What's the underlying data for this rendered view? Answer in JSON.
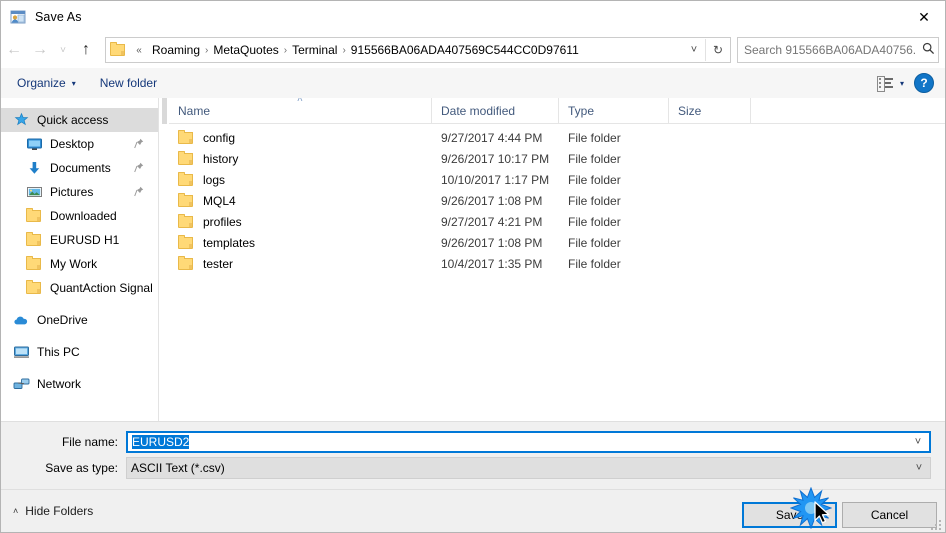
{
  "window": {
    "title": "Save As",
    "app_icon": "save-as-icon",
    "close_label": "✕"
  },
  "nav": {
    "back": "←",
    "forward": "→",
    "recent": "˅",
    "up": "↑",
    "refresh": "↻",
    "crumb_chevron": "«",
    "separator": "›",
    "breadcrumbs": [
      "Roaming",
      "MetaQuotes",
      "Terminal",
      "915566BA06ADA407569C544CC0D97611"
    ],
    "address_dropdown": "˅"
  },
  "search": {
    "placeholder": "Search 915566BA06ADA40756...",
    "value": "",
    "icon": "search-icon"
  },
  "toolbar": {
    "organize_label": "Organize",
    "organize_caret": "▾",
    "new_folder_label": "New folder",
    "view_caret": "▾",
    "help_label": "?"
  },
  "sidebar": {
    "items": [
      {
        "label": "Quick access",
        "icon": "star-icon",
        "selected": true,
        "indent": false,
        "pinned": false
      },
      {
        "label": "Desktop",
        "icon": "monitor-icon",
        "selected": false,
        "indent": true,
        "pinned": true
      },
      {
        "label": "Documents",
        "icon": "download-arrow-icon",
        "selected": false,
        "indent": true,
        "pinned": true
      },
      {
        "label": "Pictures",
        "icon": "picture-icon",
        "selected": false,
        "indent": true,
        "pinned": true
      },
      {
        "label": "Downloaded",
        "icon": "folder-icon",
        "selected": false,
        "indent": true,
        "pinned": false
      },
      {
        "label": "EURUSD H1",
        "icon": "folder-icon",
        "selected": false,
        "indent": true,
        "pinned": false
      },
      {
        "label": "My Work",
        "icon": "folder-icon",
        "selected": false,
        "indent": true,
        "pinned": false
      },
      {
        "label": "QuantAction Signal",
        "icon": "folder-icon",
        "selected": false,
        "indent": true,
        "pinned": false
      },
      {
        "label": "OneDrive",
        "icon": "cloud-icon",
        "selected": false,
        "indent": false,
        "pinned": false
      },
      {
        "label": "This PC",
        "icon": "computer-icon",
        "selected": false,
        "indent": false,
        "pinned": false
      },
      {
        "label": "Network",
        "icon": "network-icon",
        "selected": false,
        "indent": false,
        "pinned": false
      }
    ],
    "pin_glyph": "📌"
  },
  "filelist": {
    "columns": [
      "Name",
      "Date modified",
      "Type",
      "Size"
    ],
    "sort_caret": "˄",
    "rows": [
      {
        "name": "config",
        "date": "9/27/2017 4:44 PM",
        "type": "File folder",
        "size": ""
      },
      {
        "name": "history",
        "date": "9/26/2017 10:17 PM",
        "type": "File folder",
        "size": ""
      },
      {
        "name": "logs",
        "date": "10/10/2017 1:17 PM",
        "type": "File folder",
        "size": ""
      },
      {
        "name": "MQL4",
        "date": "9/26/2017 1:08 PM",
        "type": "File folder",
        "size": ""
      },
      {
        "name": "profiles",
        "date": "9/27/2017 4:21 PM",
        "type": "File folder",
        "size": ""
      },
      {
        "name": "templates",
        "date": "9/26/2017 1:08 PM",
        "type": "File folder",
        "size": ""
      },
      {
        "name": "tester",
        "date": "10/4/2017 1:35 PM",
        "type": "File folder",
        "size": ""
      }
    ]
  },
  "form": {
    "filename_label": "File name:",
    "filename_value": "EURUSD2",
    "savetype_label": "Save as type:",
    "savetype_value": "ASCII Text (*.csv)",
    "dropdown_arrow": "˅"
  },
  "footer": {
    "hide_folders_label": "Hide Folders",
    "hide_folders_caret": "˄",
    "save_label": "Save",
    "cancel_label": "Cancel"
  },
  "colors": {
    "accent": "#0078d7",
    "folder": "#ffd977",
    "help_blue": "#1175c7",
    "selection": "#dcdcdc"
  }
}
